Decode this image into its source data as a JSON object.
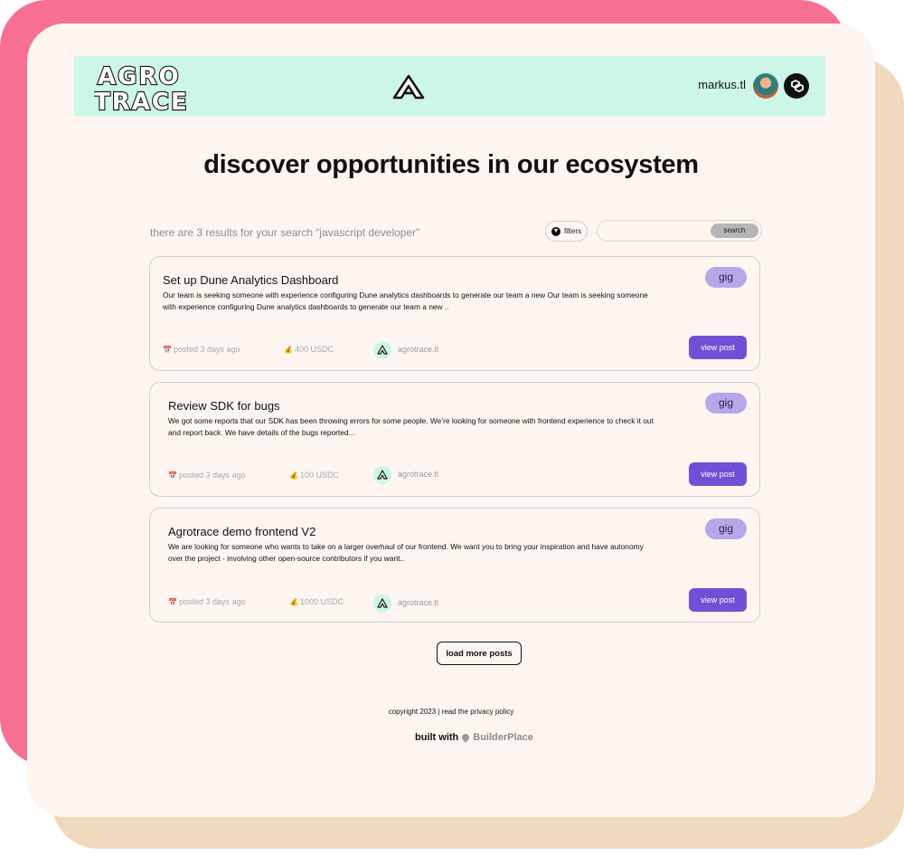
{
  "header": {
    "logo_line1": "AGRO",
    "logo_line2": "TRACE",
    "username": "markus.tl",
    "center_mark_letter": "A"
  },
  "main": {
    "title": "discover opportunities in our ecosystem",
    "results_text": "there are 3 results for your search “javascript developer”",
    "filters_label": "filters",
    "search_placeholder": "",
    "search_button_label": "search"
  },
  "posts": [
    {
      "title": "Set up Dune Analytics Dashboard",
      "description": "Our team is seeking someone with experience configuring Dune analytics dashboards to generate our team a new Our team is seeking someone with experience configuring Dune analytics dashboards to  generate our team a new ..",
      "badge": "gig",
      "posted": "posted 3 days ago",
      "reward": "400 USDC",
      "org": "agrotrace.tl",
      "button": "view post"
    },
    {
      "title": "Review SDK for bugs",
      "description": "We got some reports that our SDK has been throwing errors for some people. We’re looking for someone with frontend experience to check it out and report back. We have details of the bugs reported...",
      "badge": "gig",
      "posted": "posted 3 days ago",
      "reward": "100 USDC",
      "org": "agrotrace.tl",
      "button": "view post"
    },
    {
      "title": "Agrotrace demo frontend V2",
      "description": "We are looking for someone who wants to take on a larger overhaul of our frontend. We want you to bring your inspiration and have autonomy over the project - involving other open-source contributors if you want..",
      "badge": "gig",
      "posted": "posted 3 days ago",
      "reward": "1000 USDC",
      "org": "agrotrace.tl",
      "button": "view post"
    }
  ],
  "load_more": "load more posts",
  "footer": {
    "copyright": "copyright 2023 | read the privacy policy",
    "built_with": "built with",
    "brand": "BuilderPlace"
  },
  "colors": {
    "outer_pink": "#f86f94",
    "outer_tan": "#f1d9bd",
    "header_mint": "#ccf6e6",
    "accent_purple": "#7050d6",
    "badge_lavender": "#b7a7e9",
    "page_bg": "#fdf6f0"
  },
  "icons": {
    "calendar": "calendar-icon",
    "money_bag": "money-bag-icon",
    "wallet": "polygon-wallet-icon",
    "pin": "pin-icon",
    "filter": "arrow-down-icon"
  }
}
